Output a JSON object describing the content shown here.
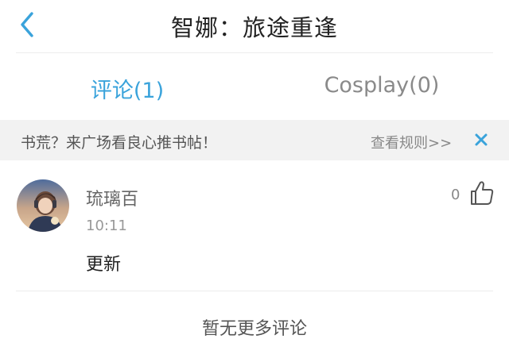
{
  "header": {
    "title": "智娜：旅途重逢",
    "back_icon": "chevron-left-icon",
    "accent_color": "#3aa3db"
  },
  "tabs": [
    {
      "label": "评论(1)",
      "active": true
    },
    {
      "label": "Cosplay(0)",
      "active": false
    }
  ],
  "notice": {
    "text": "书荒？来广场看良心推书帖！",
    "link_label": "查看规则>>",
    "close_icon": "close-icon"
  },
  "comments": [
    {
      "username": "琉璃百",
      "time": "10:11",
      "body": "更新",
      "likes": "0",
      "like_icon": "thumbs-up-icon"
    }
  ],
  "footer": {
    "no_more_text": "暂无更多评论"
  }
}
